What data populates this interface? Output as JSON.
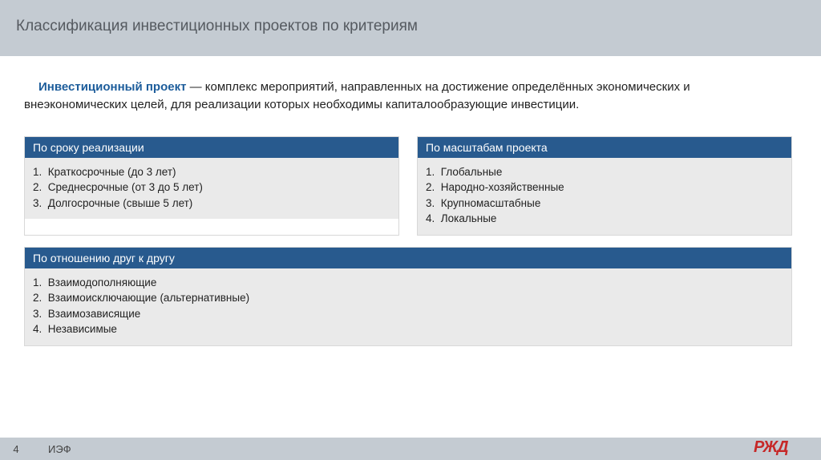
{
  "title": "Классификация инвестиционных проектов по критериям",
  "definition": {
    "term": "Инвестиционный проект",
    "text": " — комплекс мероприятий, направленных на достижение определённых экономических и внеэкономических целей, для реализации которых необходимы капиталообразующие инвестиции."
  },
  "boxes": {
    "duration": {
      "header": "По сроку реализации",
      "items": [
        "Краткосрочные (до 3 лет)",
        "Среднесрочные (от 3 до 5 лет)",
        "Долгосрочные (свыше 5 лет)"
      ]
    },
    "scale": {
      "header": "По масштабам проекта",
      "items": [
        "Глобальные",
        "Народно-хозяйственные",
        "Крупномасштабные",
        "Локальные"
      ]
    },
    "relation": {
      "header": "По отношению друг к другу",
      "items": [
        "Взаимодополняющие",
        "Взаимоисключающие (альтернативные)",
        "Взаимозависящие",
        "Независимые"
      ]
    }
  },
  "footer": {
    "page": "4",
    "label": "ИЭФ",
    "logo_text": "РЖД"
  }
}
